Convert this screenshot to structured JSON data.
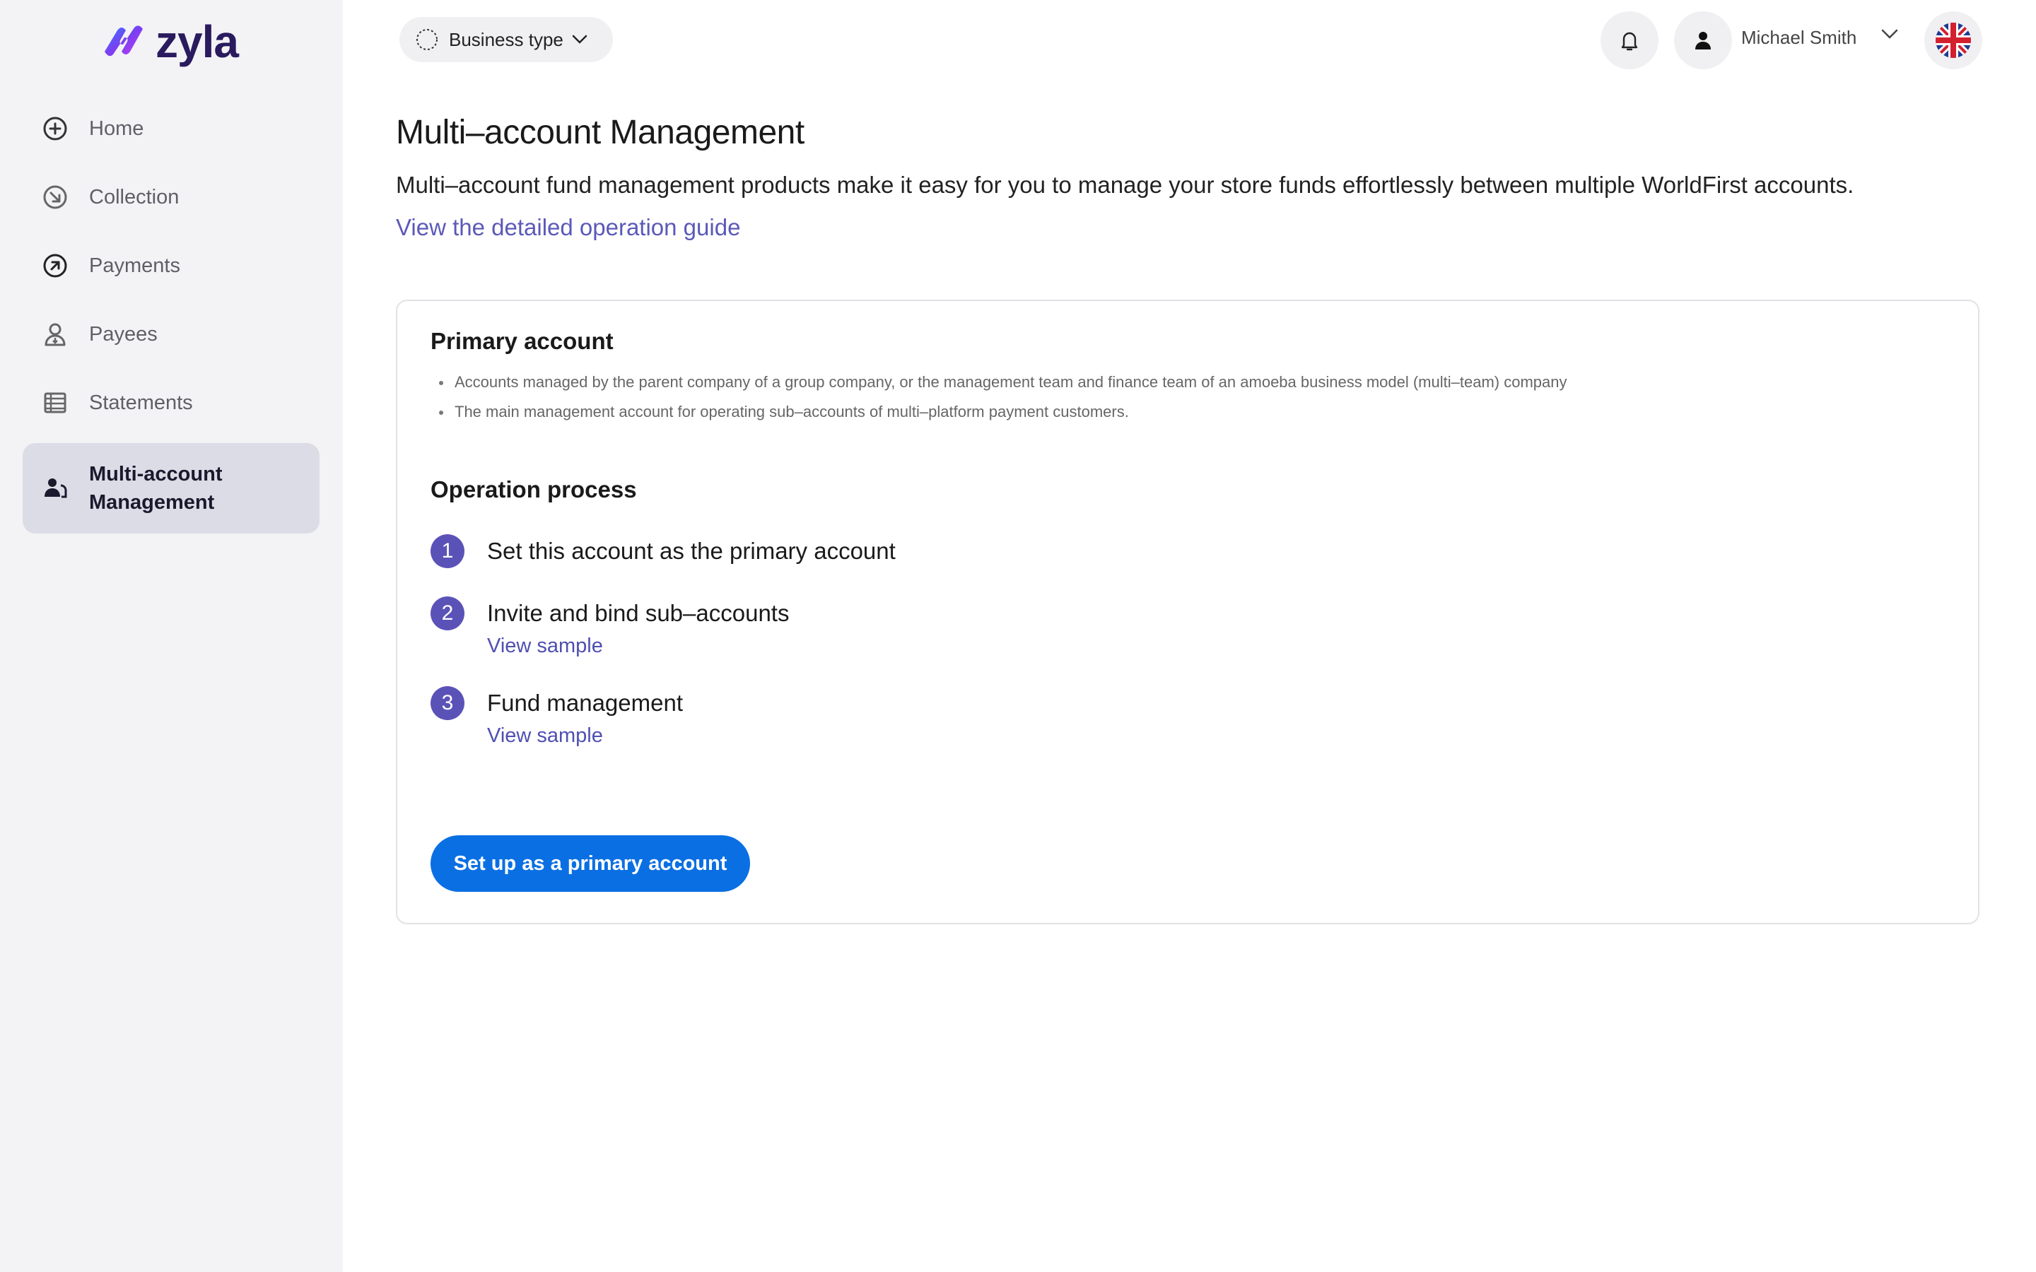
{
  "brand": {
    "name": "zyla"
  },
  "sidebar": {
    "items": [
      {
        "label": "Home",
        "icon": "home-icon"
      },
      {
        "label": "Collection",
        "icon": "collection-icon"
      },
      {
        "label": "Payments",
        "icon": "payments-icon"
      },
      {
        "label": "Payees",
        "icon": "payees-icon"
      },
      {
        "label": "Statements",
        "icon": "statements-icon"
      },
      {
        "label_line1": "Multi-account",
        "label_line2": "Management",
        "icon": "multi-account-icon",
        "active": true
      }
    ]
  },
  "header": {
    "business_type_label": "Business type",
    "user_name": "Michael Smith",
    "language_icon": "uk-flag-icon"
  },
  "main": {
    "title": "Multi–account Management",
    "description": "Multi–account fund management products make it easy for you to manage your store funds effortlessly between multiple WorldFirst accounts.",
    "guide_link": "View the detailed operation guide"
  },
  "card": {
    "primary_title": "Primary account",
    "bullets": [
      "Accounts managed by the parent company of a group company, or the management team and finance team of an amoeba business model (multi–team) company",
      "The main management account for operating sub–accounts of multi–platform payment customers."
    ],
    "operation_title": "Operation process",
    "steps": [
      {
        "num": "1",
        "title": "Set this account as the primary account"
      },
      {
        "num": "2",
        "title": "Invite and bind sub–accounts",
        "link": "View sample"
      },
      {
        "num": "3",
        "title": "Fund management",
        "link": "View sample"
      }
    ],
    "cta_label": "Set up as a primary account"
  },
  "colors": {
    "accent": "#5b59b8",
    "primary_button": "#0a6fe3",
    "step_badge": "#5b52b8",
    "sidebar_bg": "#f3f3f6",
    "active_item_bg": "#dcdce6"
  }
}
